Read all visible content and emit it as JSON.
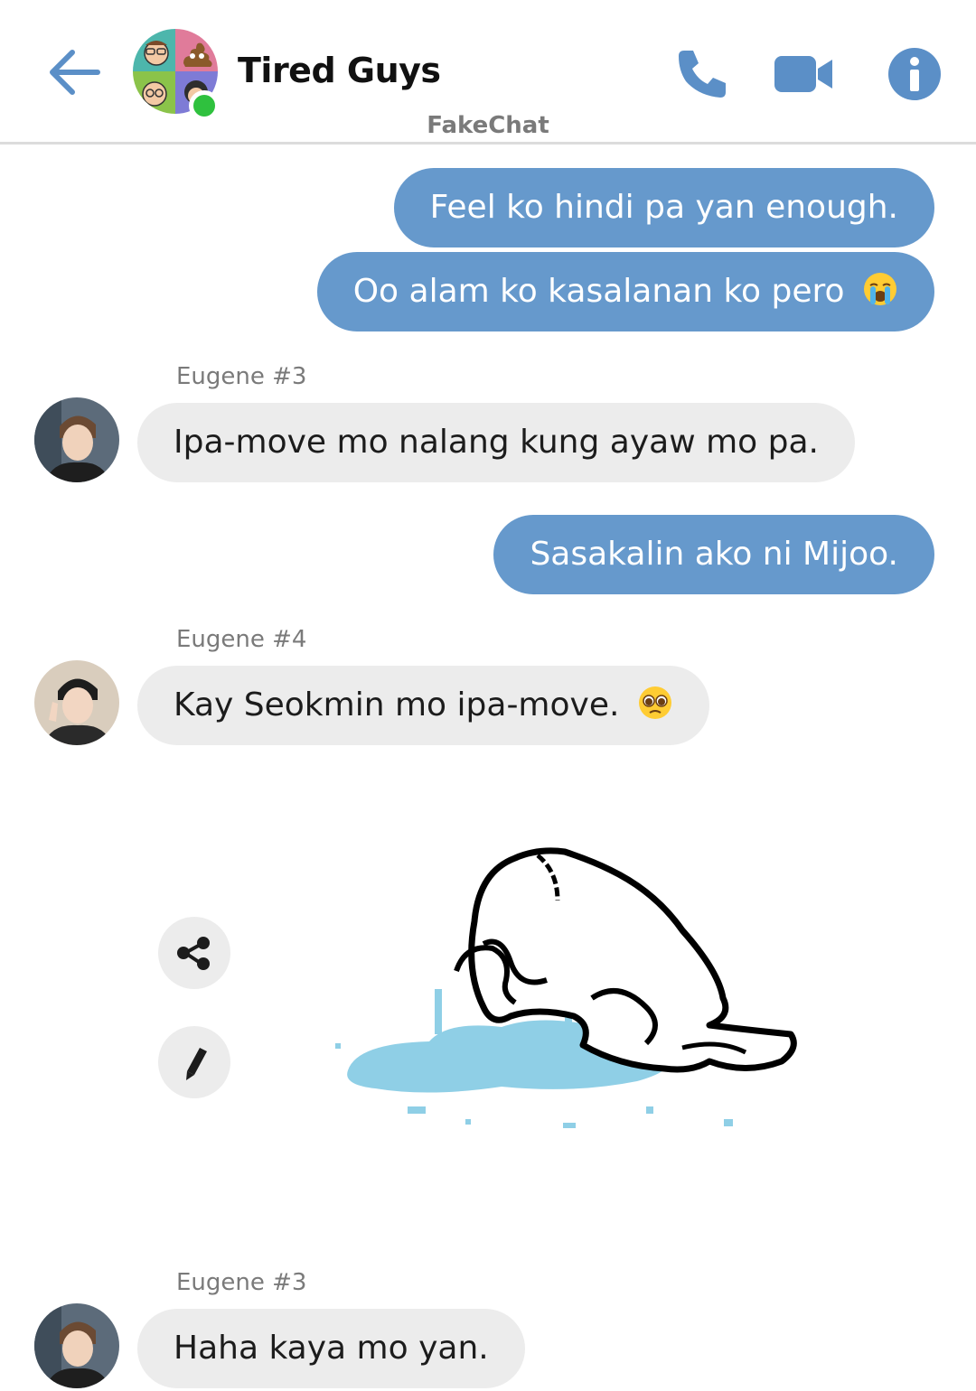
{
  "header": {
    "title": "Tired Guys",
    "watermark": "FakeChat"
  },
  "messages": [
    {
      "type": "outgoing",
      "text": "Feel ko hindi pa yan enough."
    },
    {
      "type": "outgoing",
      "text": "Oo alam ko kasalanan ko pero",
      "emoji": "loudly-crying-face-emoji"
    },
    {
      "type": "incoming",
      "sender": "Eugene #3",
      "text": "Ipa-move mo nalang kung ayaw mo pa."
    },
    {
      "type": "outgoing",
      "text": "Sasakalin ako ni Mijoo."
    },
    {
      "type": "incoming",
      "sender": "Eugene #4",
      "text": "Kay Seokmin mo ipa-move.",
      "emoji": "pleading-face-emoji"
    },
    {
      "type": "sticker",
      "sticker": "crying-puddle-sticker"
    },
    {
      "type": "incoming",
      "sender": "Eugene #3",
      "text": "Haha kaya mo yan."
    }
  ],
  "colors": {
    "outgoing_bubble": "#6699cc",
    "incoming_bubble": "#ececec",
    "accent": "#5b8fc7",
    "online": "#2fc13e",
    "puddle": "#8fcfe6"
  },
  "icons": [
    "back-arrow-icon",
    "phone-icon",
    "video-camera-icon",
    "info-icon",
    "share-icon",
    "pencil-icon"
  ]
}
